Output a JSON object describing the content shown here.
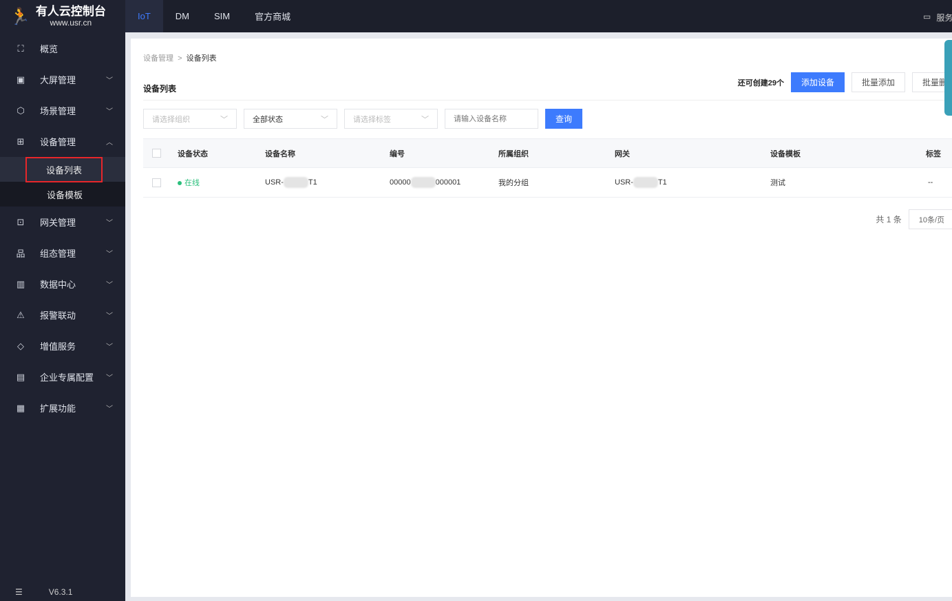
{
  "app": {
    "title": "有人云控制台",
    "url": "www.usr.cn",
    "version": "V6.3.1"
  },
  "topnav": {
    "tabs": [
      {
        "label": "IoT",
        "active": true
      },
      {
        "label": "DM"
      },
      {
        "label": "SIM"
      },
      {
        "label": "官方商城"
      }
    ],
    "service": "服务"
  },
  "sidebar": {
    "items": [
      {
        "label": "概览",
        "icon": "overview-icon",
        "glyph": "⛶"
      },
      {
        "label": "大屏管理",
        "icon": "monitor-icon",
        "glyph": "▣",
        "chev": "﹀"
      },
      {
        "label": "场景管理",
        "icon": "scene-icon",
        "glyph": "⬡",
        "chev": "﹀"
      },
      {
        "label": "设备管理",
        "icon": "device-icon",
        "glyph": "⊞",
        "chev": "︿",
        "open": true,
        "children": [
          {
            "label": "设备列表",
            "active": true
          },
          {
            "label": "设备模板"
          }
        ]
      },
      {
        "label": "网关管理",
        "icon": "gateway-icon",
        "glyph": "⊡",
        "chev": "﹀"
      },
      {
        "label": "组态管理",
        "icon": "topology-icon",
        "glyph": "品",
        "chev": "﹀"
      },
      {
        "label": "数据中心",
        "icon": "chart-icon",
        "glyph": "▥",
        "chev": "﹀"
      },
      {
        "label": "报警联动",
        "icon": "alarm-icon",
        "glyph": "⚠",
        "chev": "﹀"
      },
      {
        "label": "增值服务",
        "icon": "diamond-icon",
        "glyph": "◇",
        "chev": "﹀"
      },
      {
        "label": "企业专属配置",
        "icon": "enterprise-icon",
        "glyph": "▤",
        "chev": "﹀"
      },
      {
        "label": "扩展功能",
        "icon": "apps-icon",
        "glyph": "▦",
        "chev": "﹀"
      }
    ]
  },
  "breadcrumb": [
    "设备管理",
    "设备列表"
  ],
  "page": {
    "title": "设备列表",
    "quota": "还可创建29个",
    "add": "添加设备",
    "batch_add": "批量添加",
    "batch_delete": "批量删除"
  },
  "filters": {
    "org_placeholder": "请选择组织",
    "status_value": "全部状态",
    "tag_placeholder": "请选择标签",
    "name_placeholder": "请输入设备名称",
    "query": "查询"
  },
  "table": {
    "columns": [
      "设备状态",
      "设备名称",
      "编号",
      "所属组织",
      "网关",
      "设备模板",
      "标签"
    ],
    "rows": [
      {
        "status": "在线",
        "name_pre": "USR-",
        "name_post": "T1",
        "sn_pre": "00000",
        "sn_post": "000001",
        "org": "我的分组",
        "gw_pre": "USR-",
        "gw_post": "T1",
        "template": "测试",
        "tag": "--"
      }
    ]
  },
  "pagination": {
    "total": "共 1 条",
    "page_size": "10条/页"
  },
  "colors": {
    "accent": "#3d7bfd",
    "online": "#2bbf7c",
    "sidebar": "#1f2230"
  }
}
